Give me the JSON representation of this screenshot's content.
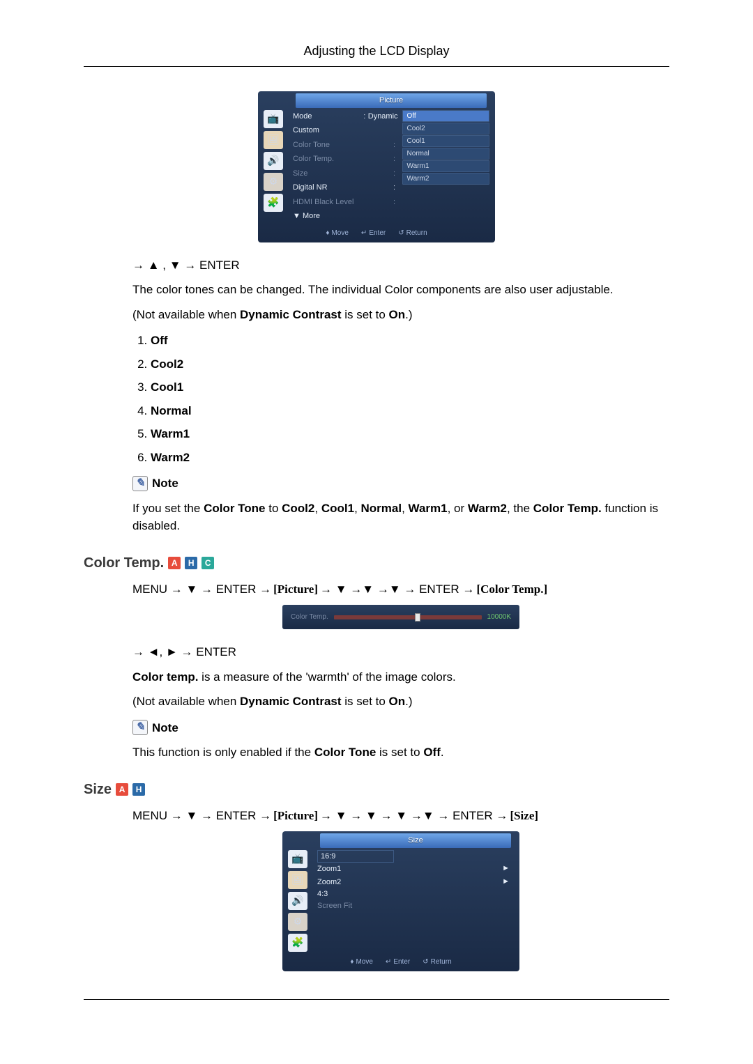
{
  "page_header": "Adjusting the LCD Display",
  "osd1": {
    "tab_title": "Picture",
    "menu": [
      {
        "label": "Mode",
        "dim": false,
        "value_inline": "Dynamic"
      },
      {
        "label": "Custom",
        "dim": false
      },
      {
        "label": "Color Tone",
        "dim": true
      },
      {
        "label": "Color Temp.",
        "dim": true
      },
      {
        "label": "Size",
        "dim": true
      },
      {
        "label": "Digital NR",
        "dim": false
      },
      {
        "label": "HDMI Black Level",
        "dim": true
      },
      {
        "label": "▼ More",
        "dim": false
      }
    ],
    "values": [
      "Off",
      "Cool2",
      "Cool1",
      "Normal",
      "Warm1",
      "Warm2"
    ],
    "selected_index": 0,
    "footer": {
      "move": "Move",
      "enter": "Enter",
      "return": "Return"
    }
  },
  "nav1": "→ ▲ , ▼ → ENTER",
  "para1": "The color tones can be changed. The individual Color components are also user adjustable.",
  "para2_pre": "(Not available when ",
  "para2_bold": "Dynamic Contrast",
  "para2_mid": " is set to ",
  "para2_bold2": "On",
  "para2_post": ".)",
  "options": [
    "Off",
    "Cool2",
    "Cool1",
    "Normal",
    "Warm1",
    "Warm2"
  ],
  "note_label": "Note",
  "note1_parts": {
    "t1": "If you set the ",
    "b1": "Color Tone",
    "t2": " to ",
    "b2": "Cool2",
    "t3": ", ",
    "b3": "Cool1",
    "t4": ", ",
    "b4": "Normal",
    "t5": ", ",
    "b5": "Warm1",
    "t6": ", or ",
    "b6": "Warm2",
    "t7": ", the ",
    "b7": "Color Temp.",
    "t8": " function is disabled."
  },
  "section_colortemp": {
    "title": "Color Temp.",
    "badges": [
      "A",
      "H",
      "C"
    ],
    "path_prefix": "MENU → ▼ → ENTER → ",
    "path_label1": "[Picture]",
    "path_mid": " → ▼ →▼ →▼ → ENTER → ",
    "path_label2": "[Color Temp.]",
    "slider_label": "Color Temp.",
    "slider_value": "10000K",
    "nav2": "→ ◄, ► → ENTER",
    "para3_b": "Color temp.",
    "para3_rest": " is a measure of the 'warmth' of the image colors.",
    "para4_pre": "(Not available when ",
    "para4_bold": "Dynamic Contrast",
    "para4_mid": " is set to ",
    "para4_bold2": "On",
    "para4_post": ".)",
    "note2_pre": "This function is only enabled if the ",
    "note2_bold": "Color Tone",
    "note2_mid": " is set to ",
    "note2_bold2": "Off",
    "note2_post": "."
  },
  "section_size": {
    "title": "Size",
    "badges": [
      "A",
      "H"
    ],
    "path_prefix": "MENU → ▼ → ENTER → ",
    "path_label1": "[Picture]",
    "path_mid": " → ▼ → ▼ → ▼ →▼ → ENTER → ",
    "path_label2": "[Size]",
    "osd": {
      "tab_title": "Size",
      "items": [
        "16:9",
        "Zoom1",
        "Zoom2",
        "4:3",
        "Screen Fit"
      ],
      "selected_index": 0,
      "arrows_right_at": [
        1,
        2
      ],
      "footer": {
        "move": "Move",
        "enter": "Enter",
        "return": "Return"
      }
    }
  }
}
